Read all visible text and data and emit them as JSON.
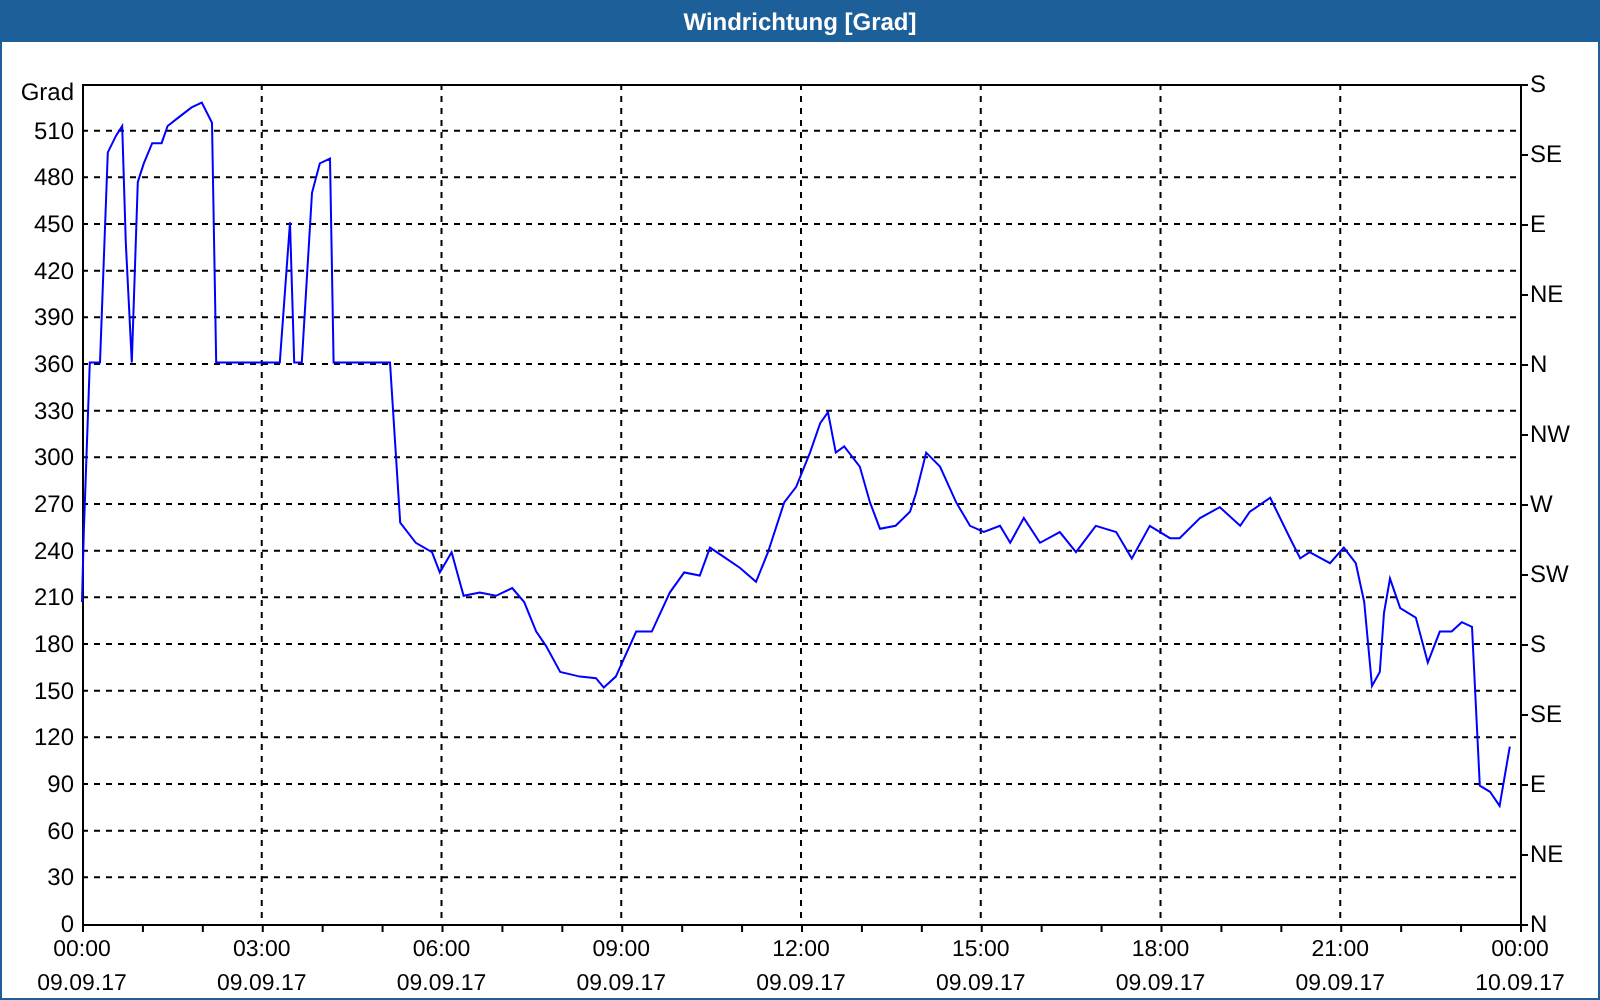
{
  "window": {
    "title": "Windrichtung [Grad]"
  },
  "panel": {
    "x_dates": [
      "09.09.17",
      "09.09.17",
      "09.09.17",
      "09.09.17",
      "09.09.17",
      "09.09.17",
      "09.09.17",
      "09.09.17",
      "10.09.17"
    ],
    "compass_ticks": [
      "S",
      "SE",
      "E",
      "NE",
      "N",
      "NW",
      "W",
      "SW",
      "S",
      "SE",
      "E",
      "NE",
      "N"
    ],
    "chart_data": {
      "type": "line",
      "ylabel": "Grad",
      "grid": true,
      "xlim": [
        0,
        24
      ],
      "ylim": [
        0,
        540
      ],
      "yticks": [
        0,
        30,
        60,
        90,
        120,
        150,
        180,
        210,
        240,
        270,
        300,
        330,
        360,
        390,
        420,
        450,
        480,
        510
      ],
      "xticks": [
        {
          "value": 0,
          "label": "00:00"
        },
        {
          "value": 3,
          "label": "03:00"
        },
        {
          "value": 6,
          "label": "06:00"
        },
        {
          "value": 9,
          "label": "09:00"
        },
        {
          "value": 12,
          "label": "12:00"
        },
        {
          "value": 15,
          "label": "15:00"
        },
        {
          "value": 18,
          "label": "18:00"
        },
        {
          "value": 21,
          "label": "21:00"
        },
        {
          "value": 24,
          "label": "00:00"
        }
      ],
      "x": [
        0,
        0.03,
        0.13,
        0.3,
        0.43,
        0.57,
        0.67,
        0.73,
        0.83,
        0.93,
        1.03,
        1.17,
        1.33,
        1.43,
        1.63,
        1.83,
        2.0,
        2.17,
        2.24,
        3.3,
        3.47,
        3.54,
        3.67,
        3.84,
        3.97,
        4.14,
        4.2,
        5.14,
        5.31,
        5.57,
        5.84,
        5.97,
        6.17,
        6.37,
        6.64,
        6.91,
        7.18,
        7.38,
        7.58,
        7.74,
        7.98,
        8.31,
        8.58,
        8.71,
        8.91,
        9.25,
        9.51,
        9.81,
        10.05,
        10.31,
        10.48,
        10.71,
        10.98,
        11.25,
        11.45,
        11.72,
        11.92,
        12.15,
        12.32,
        12.45,
        12.58,
        12.72,
        12.98,
        13.15,
        13.32,
        13.58,
        13.82,
        13.92,
        14.09,
        14.32,
        14.59,
        14.82,
        15.05,
        15.32,
        15.49,
        15.72,
        15.99,
        16.32,
        16.59,
        16.92,
        17.26,
        17.52,
        17.82,
        18.16,
        18.32,
        18.66,
        18.99,
        19.33,
        19.49,
        19.83,
        20.16,
        20.33,
        20.49,
        20.83,
        21.06,
        21.26,
        21.4,
        21.53,
        21.66,
        21.73,
        21.83,
        22.0,
        22.26,
        22.46,
        22.66,
        22.86,
        23.03,
        23.2,
        23.33,
        23.5,
        23.66,
        23.83
      ],
      "series": [
        {
          "color": "#0000ff",
          "values": [
            207,
            252,
            361,
            361,
            496,
            507,
            513,
            438,
            361,
            477,
            489,
            502,
            502,
            513,
            519,
            525,
            528,
            515,
            361,
            361,
            451,
            361,
            361,
            470,
            489,
            492,
            361,
            361,
            258,
            245,
            239,
            226,
            239,
            211,
            213,
            211,
            216,
            207,
            188,
            179,
            162,
            159,
            158,
            152,
            159,
            188,
            188,
            213,
            226,
            224,
            242,
            236,
            229,
            220,
            239,
            271,
            281,
            303,
            322,
            329,
            303,
            307,
            294,
            271,
            254,
            256,
            265,
            277,
            303,
            294,
            271,
            256,
            252,
            256,
            245,
            261,
            245,
            252,
            239,
            256,
            252,
            235,
            256,
            248,
            248,
            261,
            268,
            256,
            265,
            274,
            248,
            235,
            239,
            232,
            242,
            232,
            207,
            153,
            162,
            200,
            222,
            203,
            197,
            168,
            188,
            188,
            194,
            191,
            89,
            85,
            76,
            114
          ]
        }
      ]
    }
  }
}
